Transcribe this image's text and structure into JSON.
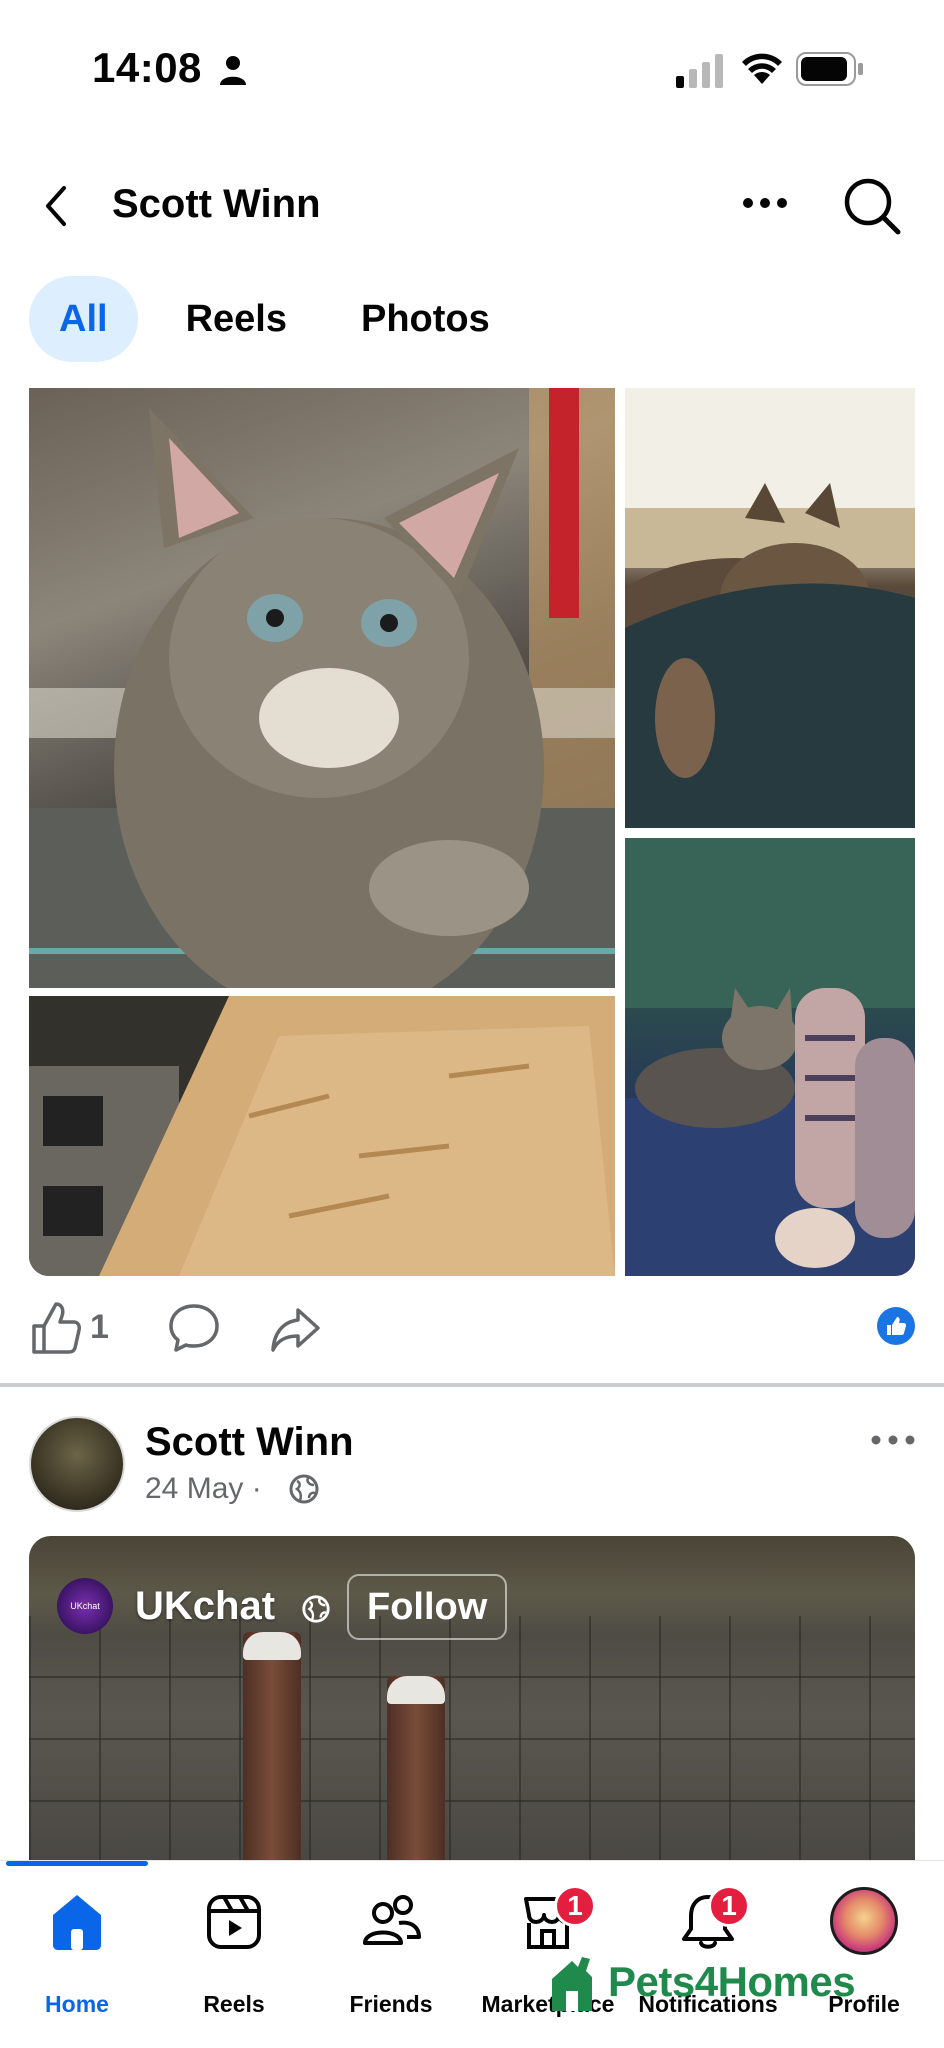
{
  "status": {
    "time": "14:08",
    "icons": [
      "person-icon",
      "signal-icon",
      "wifi-icon",
      "battery-icon"
    ]
  },
  "header": {
    "title": "Scott Winn",
    "icons": [
      "back-icon",
      "more-icon",
      "search-icon"
    ]
  },
  "tabs": [
    {
      "label": "All",
      "active": true
    },
    {
      "label": "Reels",
      "active": false
    },
    {
      "label": "Photos",
      "active": false
    }
  ],
  "post1": {
    "photos": [
      "kitten close-up",
      "wood board",
      "kitten sleeping",
      "kitten on lap"
    ],
    "like_count": "1",
    "icons": [
      "like-icon",
      "comment-icon",
      "share-icon",
      "reaction-like-icon"
    ]
  },
  "post2": {
    "author": "Scott Winn",
    "date": "24 May",
    "separator": "·",
    "shared_page": {
      "name": "UKchat",
      "avatar_text": "UKchat",
      "follow_label": "Follow"
    }
  },
  "nav": {
    "items": [
      {
        "label": "Home",
        "icon": "home-icon",
        "active": true,
        "badge": ""
      },
      {
        "label": "Reels",
        "icon": "reels-icon",
        "active": false,
        "badge": ""
      },
      {
        "label": "Friends",
        "icon": "friends-icon",
        "active": false,
        "badge": ""
      },
      {
        "label": "Marketplace",
        "icon": "marketplace-icon",
        "active": false,
        "badge": "1"
      },
      {
        "label": "Notifications",
        "icon": "bell-icon",
        "active": false,
        "badge": "1"
      },
      {
        "label": "Profile",
        "icon": "profile-avatar",
        "active": false,
        "badge": ""
      }
    ]
  },
  "watermark": "Pets4Homes",
  "colors": {
    "accent": "#0a66e8",
    "tab_active_bg": "#ddeeff",
    "badge": "#e41e3f",
    "secondary_text": "#65676b",
    "watermark": "#1f8a4c"
  }
}
